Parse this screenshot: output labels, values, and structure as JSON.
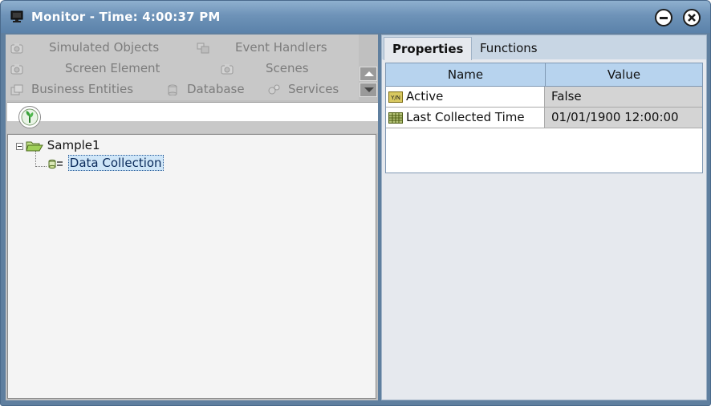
{
  "window": {
    "title": "Monitor - Time: 4:00:37 PM"
  },
  "left_nav": {
    "items": [
      {
        "label": "Simulated Objects",
        "icon": "camera-icon"
      },
      {
        "label": "Event Handlers",
        "icon": "event-handler-icon"
      },
      {
        "label": "Screen Element",
        "icon": "camera-icon"
      },
      {
        "label": "Scenes",
        "icon": "camera-icon"
      },
      {
        "label": "Business Entities",
        "icon": "business-entity-icon"
      },
      {
        "label": "Database",
        "icon": "database-icon"
      },
      {
        "label": "Services",
        "icon": "gear-icon"
      }
    ]
  },
  "tree": {
    "root": "Sample1",
    "child": "Data Collection"
  },
  "tabs": [
    {
      "label": "Properties",
      "active": true
    },
    {
      "label": "Functions",
      "active": false
    }
  ],
  "properties_grid": {
    "columns": [
      "Name",
      "Value"
    ],
    "rows": [
      {
        "name": "Active",
        "value": "False",
        "icon": "yes-no-icon"
      },
      {
        "name": "Last Collected Time",
        "value": "01/01/1900 12:00:00",
        "icon": "calendar-icon"
      }
    ]
  },
  "colors": {
    "titlebar": "#6e93b8",
    "grid_header": "#b7d3ee",
    "tree_selection": "#cfe6f8"
  }
}
